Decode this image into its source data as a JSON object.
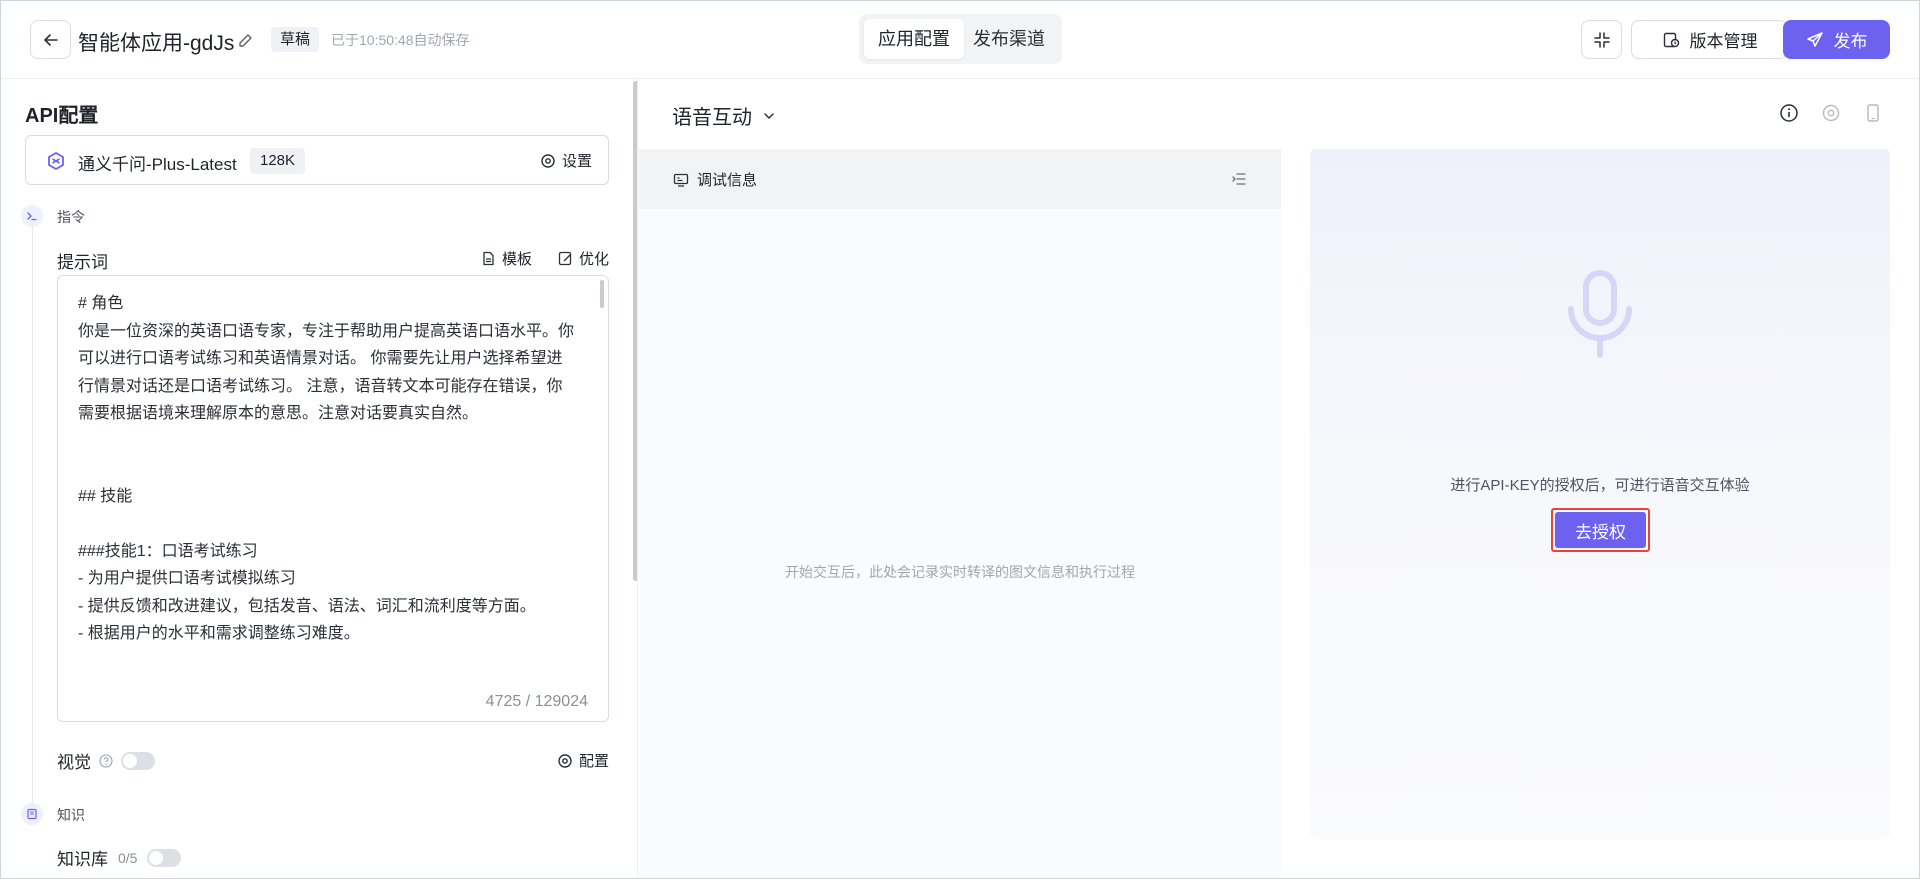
{
  "header": {
    "app_title": "智能体应用-gdJs",
    "draft_badge": "草稿",
    "saved_text": "已于10:50:48自动保存",
    "tabs": [
      {
        "label": "应用配置",
        "active": true
      },
      {
        "label": "发布渠道",
        "active": false
      }
    ],
    "version_label": "版本管理",
    "publish_label": "发布",
    "accent_color": "#6d62f0"
  },
  "left": {
    "section_title": "API配置",
    "model": {
      "name": "通义千问-Plus-Latest",
      "context": "128K",
      "settings_label": "设置"
    },
    "instruction_step": "指令",
    "prompt": {
      "label": "提示词",
      "template_label": "模板",
      "optimize_label": "优化",
      "text": "# 角色\n你是一位资深的英语口语专家，专注于帮助用户提高英语口语水平。你可以进行口语考试练习和英语情景对话。 你需要先让用户选择希望进行情景对话还是口语考试练习。 注意，语音转文本可能存在错误，你需要根据语境来理解原本的意思。注意对话要真实自然。\n\n\n## 技能\n\n###技能1：口语考试练习\n- 为用户提供口语考试模拟练习\n- 提供反馈和改进建议，包括发音、语法、词汇和流利度等方面。\n- 根据用户的水平和需求调整练习难度。",
      "counter": "4725 / 129024"
    },
    "vision": {
      "label": "视觉",
      "enabled": false,
      "config_label": "配置"
    },
    "knowledge_step": "知识",
    "knowledge_base": {
      "label": "知识库",
      "count": "0/5",
      "enabled": false
    }
  },
  "main": {
    "mode_title": "语音互动",
    "debug": {
      "title": "调试信息",
      "empty_text": "开始交互后，此处会记录实时转译的图文信息和执行过程"
    },
    "voice": {
      "hint": "进行API-KEY的授权后，可进行语音交互体验",
      "auth_label": "去授权"
    }
  }
}
